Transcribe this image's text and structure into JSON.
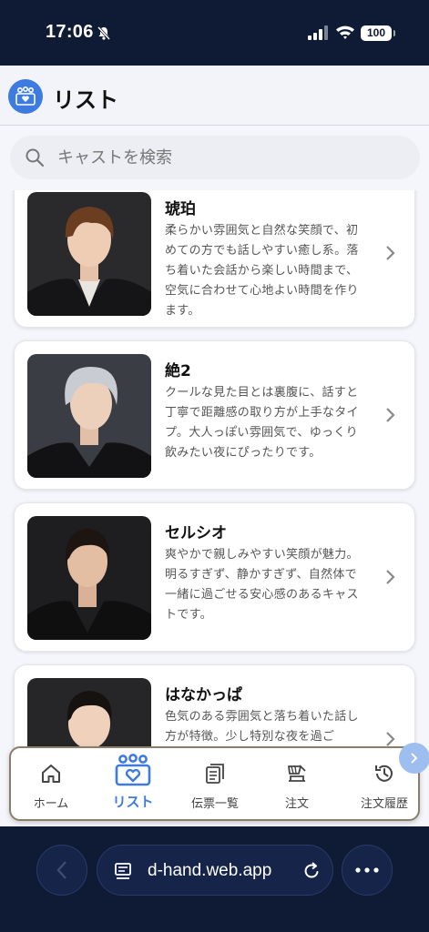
{
  "status_bar": {
    "time": "17:06",
    "battery": "100"
  },
  "header": {
    "title": "リスト",
    "logo_icon": "cast-list-icon"
  },
  "search": {
    "placeholder": "キャストを検索"
  },
  "casts": [
    {
      "name": "琥珀",
      "description": "柔らかい雰囲気と自然な笑顔で、初めての方でも話しやすい癒し系。落ち着いた会話から楽しい時間まで、空気に合わせて心地よい時間を作ります。"
    },
    {
      "name": "絶2",
      "description": "クールな見た目とは裏腹に、話すと丁寧で距離感の取り方が上手なタイプ。大人っぽい雰囲気で、ゆっくり飲みたい夜にぴったりです。"
    },
    {
      "name": "セルシオ",
      "description": "爽やかで親しみやすい笑顔が魅力。明るすぎず、静かすぎず、自然体で一緒に過ごせる安心感のあるキャストです。"
    },
    {
      "name": "はなかっぱ",
      "description": "色気のある雰囲気と落ち着いた話し方が特徴。少し特別な夜を過ご"
    }
  ],
  "nav": {
    "items": [
      {
        "label": "ホーム",
        "icon": "home-icon"
      },
      {
        "label": "リスト",
        "icon": "cast-list-icon"
      },
      {
        "label": "伝票一覧",
        "icon": "receipt-list-icon"
      },
      {
        "label": "注文",
        "icon": "order-icon"
      },
      {
        "label": "注文履歴",
        "icon": "history-icon"
      }
    ],
    "active_color": "#3d7be0"
  },
  "browser": {
    "url": "d-hand.web.app"
  }
}
